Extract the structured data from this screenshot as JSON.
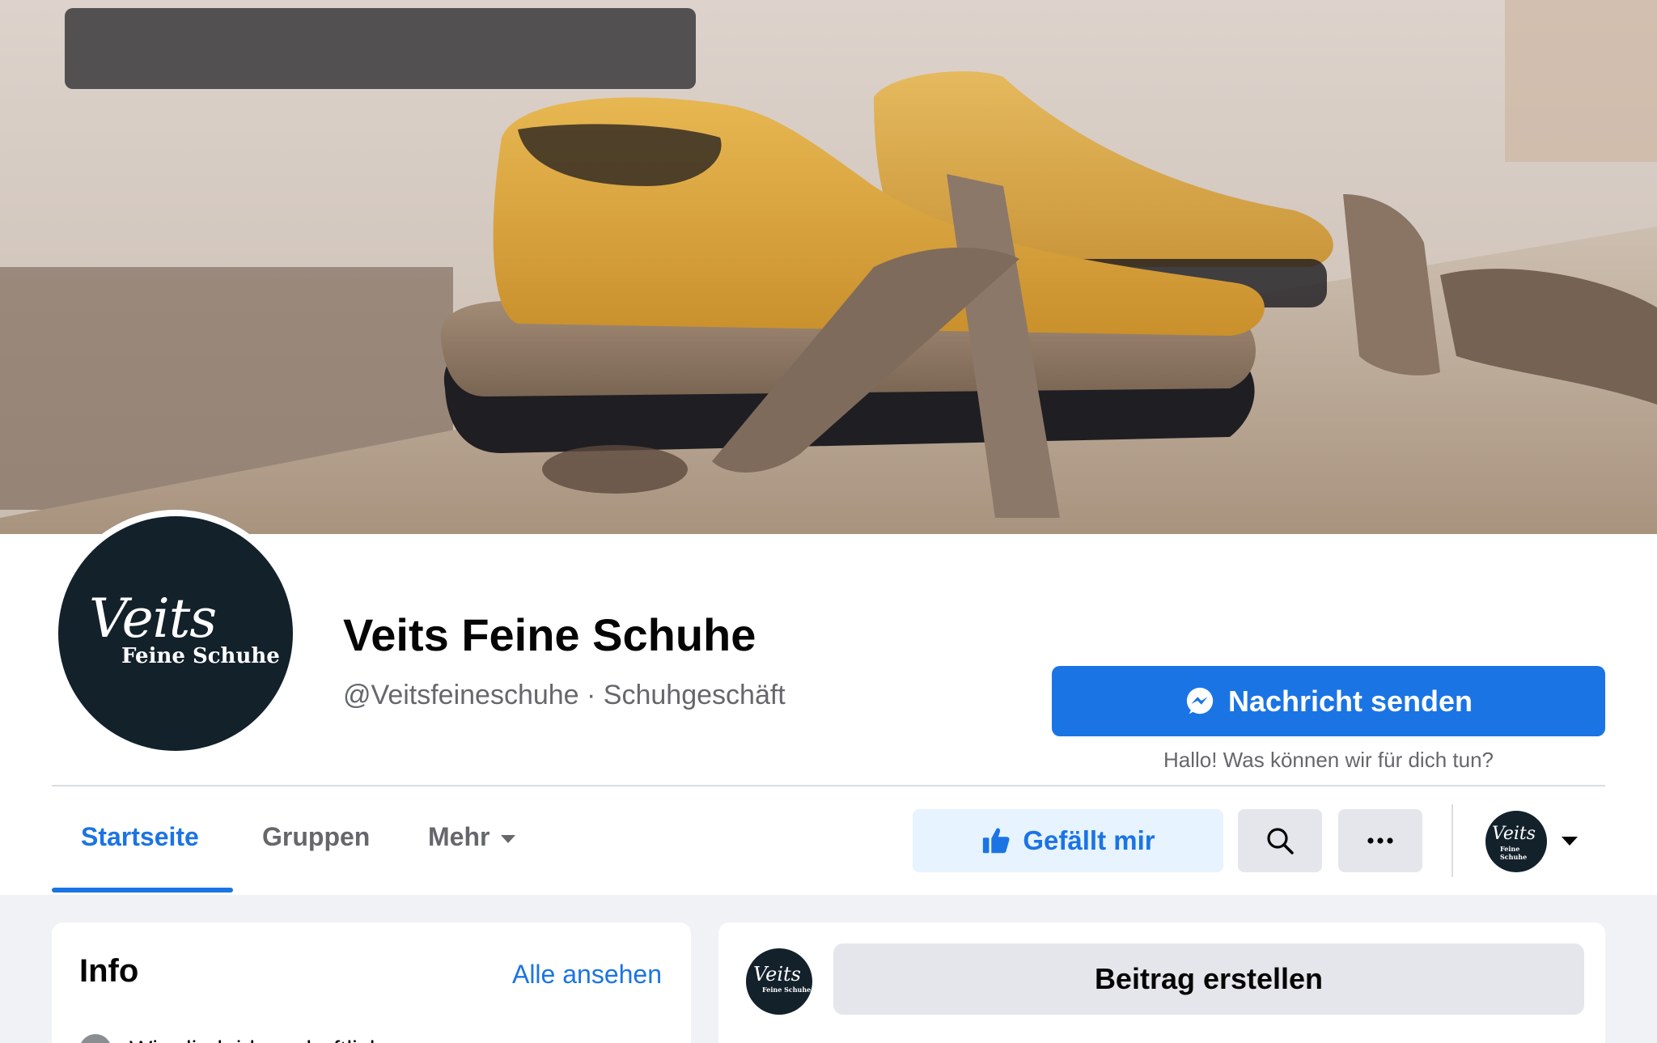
{
  "cover": {
    "image": "cover-photo-shoe-lasts-workshop"
  },
  "profile": {
    "logo_script": "Veits",
    "logo_sub": "Feine Schuhe",
    "name": "Veits Feine Schuhe",
    "handle_category": "@Veitsfeineschuhe · Schuhgeschäft"
  },
  "actions": {
    "message_label": "Nachricht senden",
    "greeting": "Hallo! Was können wir für dich tun?",
    "like_label": "Gefällt mir"
  },
  "tabs": [
    {
      "label": "Startseite",
      "active": true
    },
    {
      "label": "Gruppen",
      "active": false
    },
    {
      "label": "Mehr",
      "active": false
    }
  ],
  "info": {
    "title": "Info",
    "see_all": "Alle ansehen",
    "first_line": "Wir, die leidenschaftlichen"
  },
  "composer": {
    "label": "Beitrag erstellen"
  },
  "colors": {
    "accent": "#1b74e4",
    "accent_light": "#e7f3ff",
    "logo_bg": "#13212b",
    "secondary_text": "#65676b",
    "page_bg": "#f0f2f5"
  }
}
